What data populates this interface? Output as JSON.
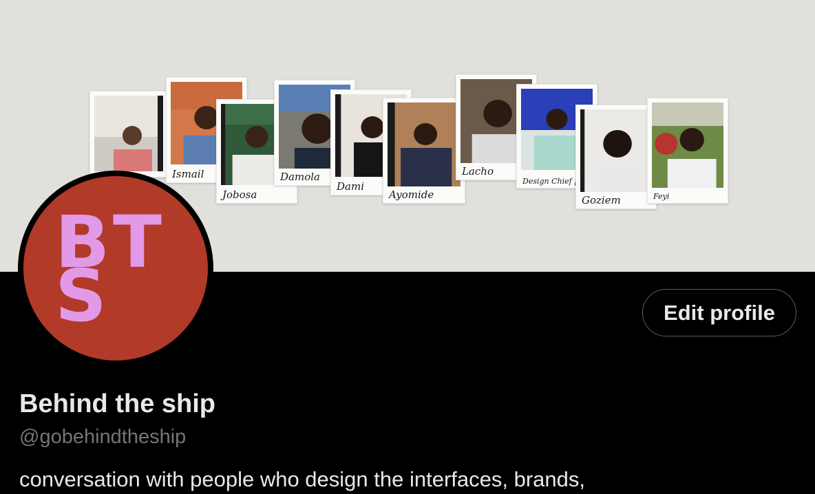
{
  "banner": {
    "background_color": "#e2e0dc",
    "polaroids": [
      {
        "caption": ""
      },
      {
        "caption": "Ismail"
      },
      {
        "caption": "Jobosa"
      },
      {
        "caption": "Damola"
      },
      {
        "caption": "Dami"
      },
      {
        "caption": "Ayomide"
      },
      {
        "caption": "Lacho"
      },
      {
        "caption": "Design Chief pst"
      },
      {
        "caption": "Goziem"
      },
      {
        "caption": "Feyi"
      }
    ]
  },
  "avatar": {
    "background_color": "#b23a29",
    "letters": {
      "b": "B",
      "t": "T",
      "s": "S"
    },
    "letter_color": "#e29ae8"
  },
  "actions": {
    "edit_profile_label": "Edit profile"
  },
  "profile": {
    "display_name": "Behind the ship",
    "handle": "@gobehindtheship",
    "bio": "conversation with people who design the interfaces, brands,"
  }
}
